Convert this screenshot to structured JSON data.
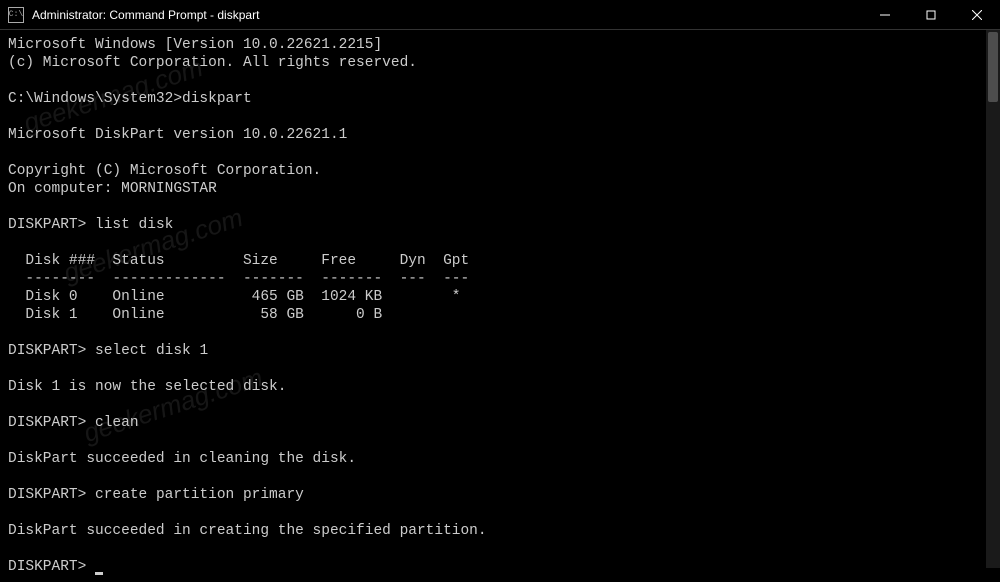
{
  "titlebar": {
    "title": "Administrator: Command Prompt - diskpart"
  },
  "terminal": {
    "header1": "Microsoft Windows [Version 10.0.22621.2215]",
    "header2": "(c) Microsoft Corporation. All rights reserved.",
    "prompt1_path": "C:\\Windows\\System32>",
    "prompt1_cmd": "diskpart",
    "diskpart_version": "Microsoft DiskPart version 10.0.22621.1",
    "copyright": "Copyright (C) Microsoft Corporation.",
    "computer": "On computer: MORNINGSTAR",
    "dp_prompt": "DISKPART>",
    "cmd_listdisk": "list disk",
    "table_header": "  Disk ###  Status         Size     Free     Dyn  Gpt",
    "table_divider": "  --------  -------------  -------  -------  ---  ---",
    "table_row0": "  Disk 0    Online          465 GB  1024 KB        *",
    "table_row1": "  Disk 1    Online           58 GB      0 B",
    "cmd_select": "select disk 1",
    "select_result": "Disk 1 is now the selected disk.",
    "cmd_clean": "clean",
    "clean_result": "DiskPart succeeded in cleaning the disk.",
    "cmd_create": "create partition primary",
    "create_result": "DiskPart succeeded in creating the specified partition."
  },
  "watermark": "geekermag.com"
}
